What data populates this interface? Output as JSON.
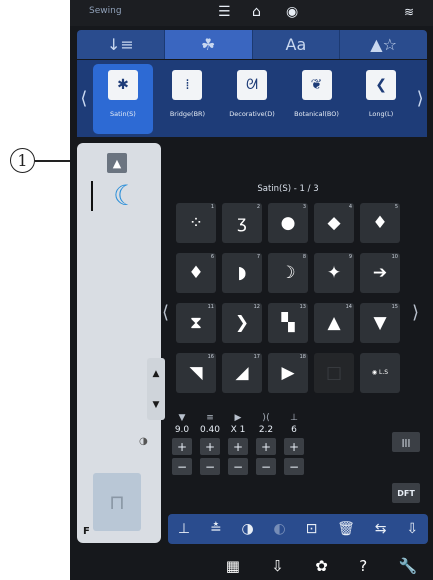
{
  "callout": {
    "number": "1"
  },
  "status_bar": {
    "title": "Sewing",
    "menu_icon": "☰",
    "home_icon": "⌂",
    "back_icon": "◉",
    "wifi_icon": "≋"
  },
  "category_tabs": [
    {
      "label": "↓≡",
      "icon": "utility-stitch-icon"
    },
    {
      "label": "☘",
      "icon": "decorative-stitch-icon"
    },
    {
      "label": "Aa",
      "icon": "alphabet-icon"
    },
    {
      "label": "▲☆",
      "icon": "favorites-icon"
    }
  ],
  "stitch_categories": [
    {
      "label": "Satin(S)",
      "glyph": "✱",
      "active": true
    },
    {
      "label": "Bridge(BR)",
      "glyph": "⁞",
      "active": false
    },
    {
      "label": "Decorative(D)",
      "glyph": "ᘛ",
      "active": false
    },
    {
      "label": "Botanical(BO)",
      "glyph": "❦",
      "active": false
    },
    {
      "label": "Long(L)",
      "glyph": "❮",
      "active": false
    }
  ],
  "grid": {
    "caption": "Satin(S) - 1 / 3",
    "cells": [
      {
        "num": "1",
        "glyph": "⁘"
      },
      {
        "num": "2",
        "glyph": "ʒ"
      },
      {
        "num": "3",
        "glyph": "●"
      },
      {
        "num": "4",
        "glyph": "◆"
      },
      {
        "num": "5",
        "glyph": "♦"
      },
      {
        "num": "6",
        "glyph": "♦"
      },
      {
        "num": "7",
        "glyph": "◗"
      },
      {
        "num": "8",
        "glyph": "☽"
      },
      {
        "num": "9",
        "glyph": "✦"
      },
      {
        "num": "10",
        "glyph": "➔"
      },
      {
        "num": "11",
        "glyph": "⧗"
      },
      {
        "num": "12",
        "glyph": "❯"
      },
      {
        "num": "13",
        "glyph": "▚"
      },
      {
        "num": "14",
        "glyph": "▲"
      },
      {
        "num": "15",
        "glyph": "▼"
      },
      {
        "num": "16",
        "glyph": "◥"
      },
      {
        "num": "17",
        "glyph": "◢"
      },
      {
        "num": "18",
        "glyph": "▶"
      },
      {
        "num": "",
        "glyph": "□"
      },
      {
        "num": "",
        "glyph": "◉ L.S"
      }
    ]
  },
  "params": {
    "icons": [
      "▼",
      "≡",
      "▶",
      "⟩⟨",
      "⊥"
    ],
    "values": [
      "9.0",
      "0.40",
      "X 1",
      "2.2",
      "6"
    ],
    "plus": "+",
    "minus": "−"
  },
  "right_buttons": {
    "mirror_label": "|||",
    "dft_label": "DFT"
  },
  "toolbar": [
    "⊥",
    "≛",
    "◑",
    "◐",
    "⊡",
    "🗑",
    "⇆",
    "⇩"
  ],
  "footer": [
    "▦",
    "⇩",
    "✿",
    "?",
    "🔧"
  ],
  "left_panel": {
    "foot_letter": "F"
  }
}
